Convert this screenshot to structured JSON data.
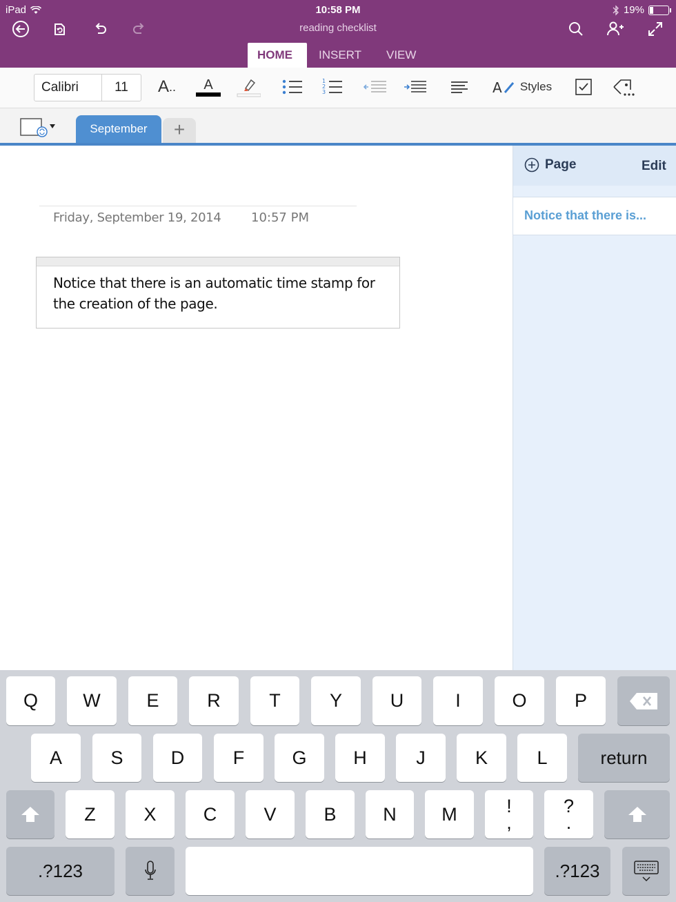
{
  "status": {
    "device": "iPad",
    "time": "10:58 PM",
    "battery": "19%"
  },
  "notebook_title": "reading checklist",
  "ribbon_tabs": [
    {
      "label": "HOME"
    },
    {
      "label": "INSERT"
    },
    {
      "label": "VIEW"
    }
  ],
  "toolbar": {
    "font_name": "Calibri",
    "font_size": "11",
    "styles_label": "Styles",
    "font_icon_label": "A",
    "font_color_label": "A"
  },
  "section_tab": "September",
  "add_section": "+",
  "pages_panel": {
    "add_page_label": "Page",
    "edit_label": "Edit",
    "pages": [
      "Notice that there is..."
    ]
  },
  "note": {
    "date": "Friday, September 19, 2014",
    "time": "10:57 PM",
    "text_line1": "Notice that there is an automatic time stamp for",
    "text_line2": "the creation of the page."
  },
  "keyboard": {
    "row1": [
      "Q",
      "W",
      "E",
      "R",
      "T",
      "Y",
      "U",
      "I",
      "O",
      "P"
    ],
    "row2": [
      "A",
      "S",
      "D",
      "F",
      "G",
      "H",
      "J",
      "K",
      "L"
    ],
    "return_label": "return",
    "row3": [
      "Z",
      "X",
      "C",
      "V",
      "B",
      "N",
      "M"
    ],
    "punct1": {
      "top": "!",
      "bottom": ","
    },
    "punct2": {
      "top": "?",
      "bottom": "."
    },
    "numbers_label": ".?123"
  },
  "colors": {
    "brand": "#80397b",
    "section": "#4f8fd1",
    "link": "#5a9fd4"
  }
}
